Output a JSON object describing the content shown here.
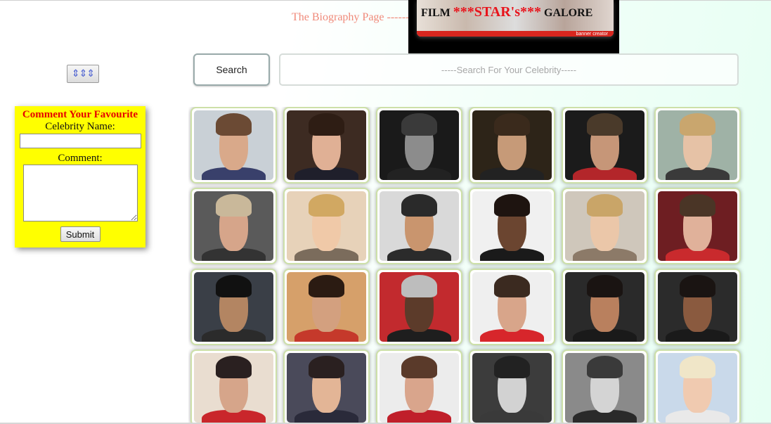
{
  "header": {
    "title": "The Biography Page ------",
    "banner": {
      "word1": "FILM",
      "stars_left": "***",
      "word2": "STAR's",
      "stars_right": "***",
      "word3": "GALORE",
      "credit": "banner creator"
    }
  },
  "toolbar": {
    "toggle_label": "⇕⇕⇕",
    "search_button": "Search",
    "search_placeholder": "-----Search For Your Celebrity-----"
  },
  "comment_form": {
    "title": "Comment Your Favourite",
    "name_label": "Celebrity Name:",
    "comment_label": "Comment:",
    "submit_label": "Submit",
    "name_value": "",
    "comment_value": ""
  },
  "gallery": {
    "rows": 4,
    "columns": 6,
    "cards": [
      {
        "bg": "#c9d0d6",
        "skin": "#d9a98a",
        "hair": "#6b4a34",
        "body": "#39406b"
      },
      {
        "bg": "#3d2b22",
        "skin": "#e0b095",
        "hair": "#2e1d14",
        "body": "#1f1f2b"
      },
      {
        "bg": "#1a1a1a",
        "skin": "#8c8c8c",
        "hair": "#3a3a3a",
        "body": "#222222"
      },
      {
        "bg": "#2d2418",
        "skin": "#c69a78",
        "hair": "#3a2a1c",
        "body": "#222222"
      },
      {
        "bg": "#1b1b1b",
        "skin": "#c69678",
        "hair": "#4a3a2a",
        "body": "#b3262a"
      },
      {
        "bg": "#9fb2a6",
        "skin": "#e6c2a6",
        "hair": "#c9a66e",
        "body": "#3a3a3a"
      },
      {
        "bg": "#5a5a5a",
        "skin": "#d6a58a",
        "hair": "#c9b89a",
        "body": "#333333"
      },
      {
        "bg": "#e7d2b9",
        "skin": "#f0c9a8",
        "hair": "#d1a862",
        "body": "#7b6c5c"
      },
      {
        "bg": "#d9d9d9",
        "skin": "#c9956e",
        "hair": "#2a2a2a",
        "body": "#2b2b2b"
      },
      {
        "bg": "#f0f0f0",
        "skin": "#6b4530",
        "hair": "#1e1410",
        "body": "#1a1a1a"
      },
      {
        "bg": "#cfc7bb",
        "skin": "#ebc7a9",
        "hair": "#c9a568",
        "body": "#8c7a68"
      },
      {
        "bg": "#6e1e22",
        "skin": "#e0b19a",
        "hair": "#4a3526",
        "body": "#c92a2d"
      },
      {
        "bg": "#3a3f47",
        "skin": "#b38562",
        "hair": "#111111",
        "body": "#2b2b2b"
      },
      {
        "bg": "#d6a06a",
        "skin": "#d3a07f",
        "hair": "#2b1b12",
        "body": "#c5392b"
      },
      {
        "bg": "#c22a2e",
        "skin": "#5c3b2a",
        "hair": "#bdbdbd",
        "body": "#1e1e1e"
      },
      {
        "bg": "#efefef",
        "skin": "#d8a58a",
        "hair": "#3b2a20",
        "body": "#d7262b"
      },
      {
        "bg": "#2a2a2a",
        "skin": "#b9805e",
        "hair": "#1a1412",
        "body": "#1a1a1a"
      },
      {
        "bg": "#2b2b2b",
        "skin": "#8a5a3f",
        "hair": "#1a1412",
        "body": "#1a1a1a"
      },
      {
        "bg": "#e9ddd0",
        "skin": "#d6a58a",
        "hair": "#2a2020",
        "body": "#c9262b"
      },
      {
        "bg": "#4a4a5a",
        "skin": "#e3b596",
        "hair": "#2a2020",
        "body": "#2a2a3a"
      },
      {
        "bg": "#ececec",
        "skin": "#d9a58c",
        "hair": "#5a3a2a",
        "body": "#c01f2a"
      },
      {
        "bg": "#3c3c3c",
        "skin": "#d2d2d2",
        "hair": "#222222",
        "body": "#3a3a3a"
      },
      {
        "bg": "#8a8a8a",
        "skin": "#d4d4d4",
        "hair": "#3a3a3a",
        "body": "#2a2a2a"
      },
      {
        "bg": "#c9d9ea",
        "skin": "#f0cab0",
        "hair": "#f0e6c8",
        "body": "#e9e9e9"
      }
    ]
  }
}
